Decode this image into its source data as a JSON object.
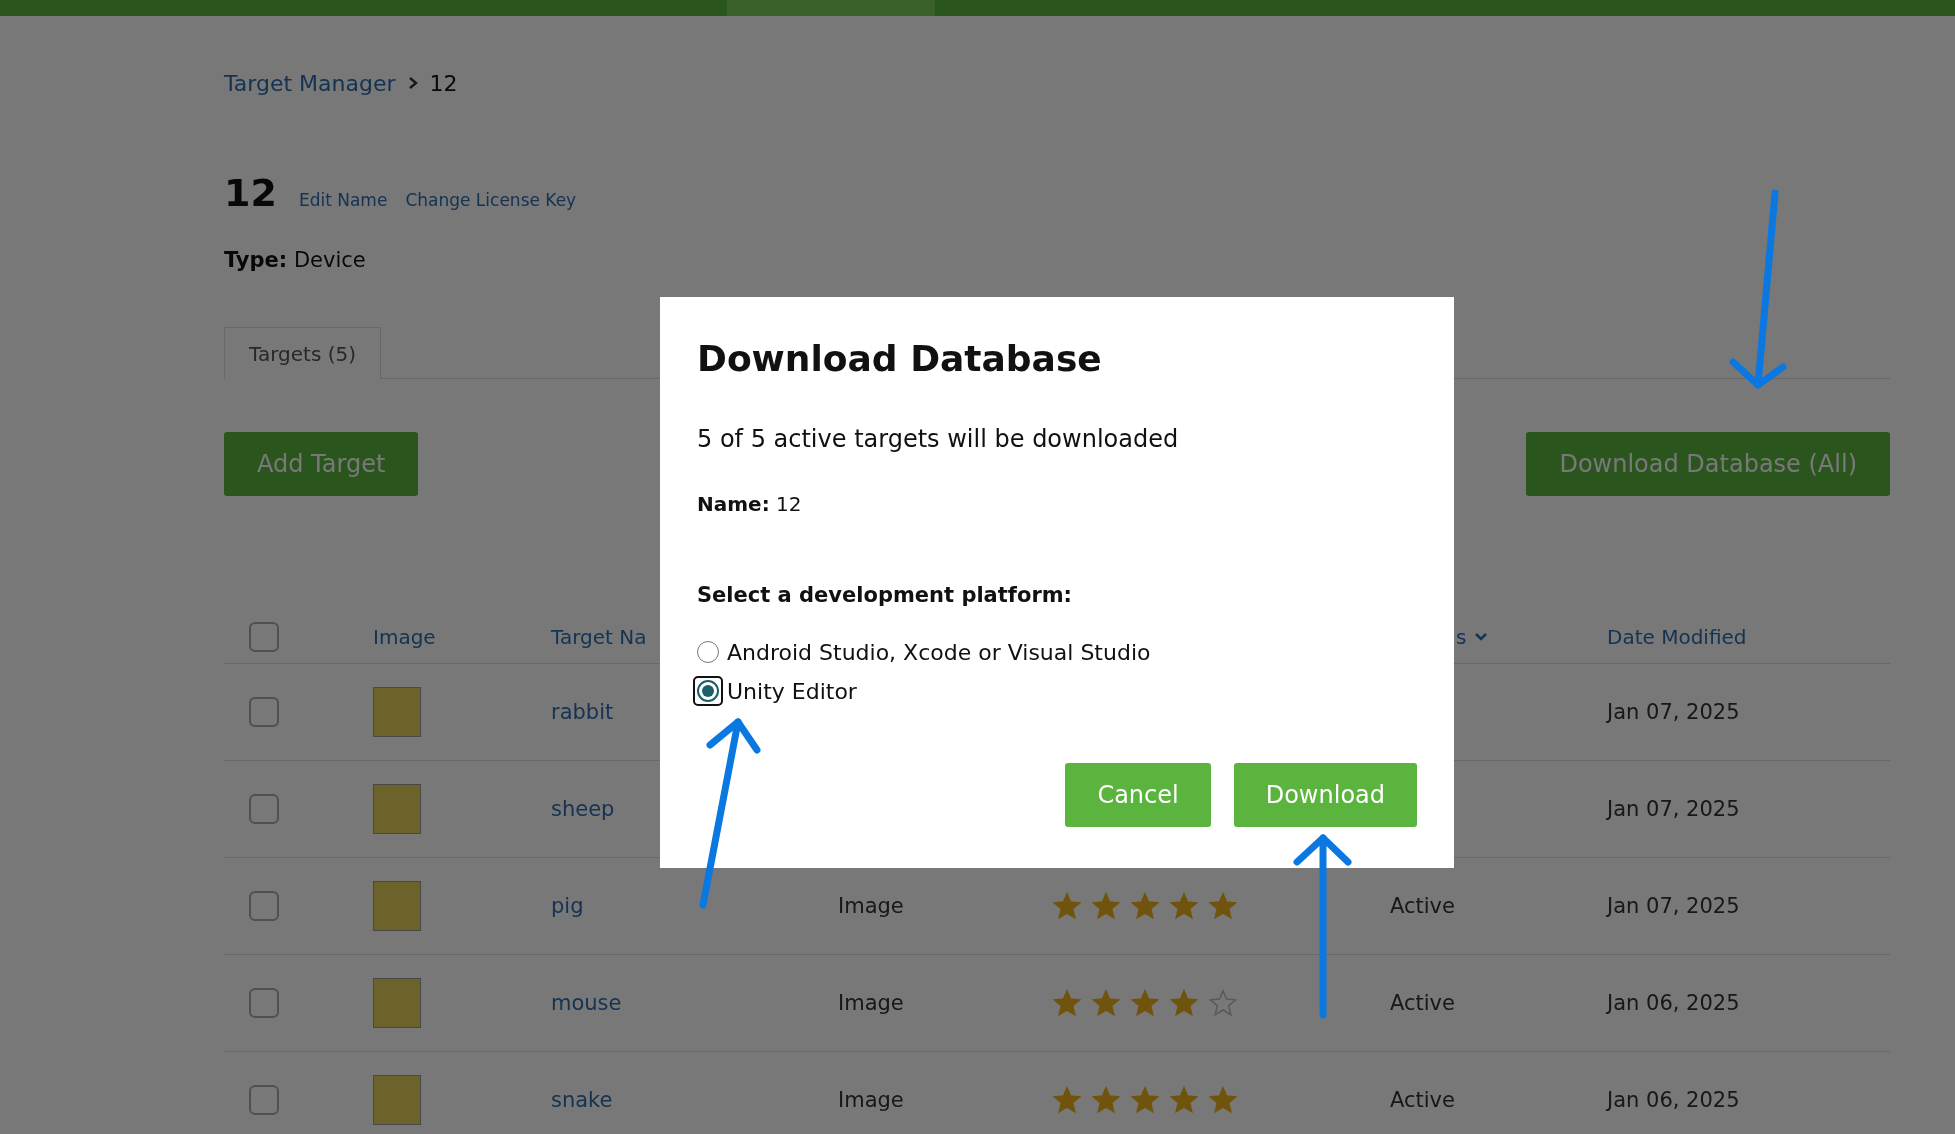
{
  "breadcrumb": [
    {
      "kind": "link",
      "label": "Target Manager"
    },
    {
      "kind": "current",
      "label": "12"
    }
  ],
  "database": {
    "name": "12",
    "actions": [
      "Edit Name",
      "Change License Key"
    ],
    "type_label": "Type:",
    "type_value": "Device"
  },
  "tabs": [
    {
      "label": "Targets (5)",
      "selected": true
    }
  ],
  "actions": {
    "add": "Add Target",
    "download_all": "Download Database (All)"
  },
  "table": {
    "select_all_checked": false,
    "columns": [
      {
        "kind": "image",
        "label": "Image"
      },
      {
        "kind": "name",
        "label": "Target Na"
      },
      {
        "kind": "status",
        "label": "s",
        "sortable": true
      },
      {
        "kind": "date",
        "label": "Date Modified"
      }
    ],
    "rows": [
      {
        "checked": false,
        "name": "rabbit",
        "date": "Jan 07, 2025"
      },
      {
        "checked": false,
        "name": "sheep",
        "date": "Jan 07, 2025"
      },
      {
        "checked": false,
        "name": "pig",
        "type": "Image",
        "stars": 5,
        "status": "Active",
        "date": "Jan 07, 2025"
      },
      {
        "checked": false,
        "name": "mouse",
        "type": "Image",
        "stars": 4,
        "status": "Active",
        "date": "Jan 06, 2025"
      },
      {
        "checked": false,
        "name": "snake",
        "type": "Image",
        "stars": 5,
        "status": "Active",
        "date": "Jan 06, 2025"
      }
    ]
  },
  "dialog": {
    "title": "Download Database",
    "summary": "5 of 5 active targets will be downloaded",
    "name_label": "Name:",
    "name_value": "12",
    "platform_heading": "Select a development platform:",
    "options": [
      {
        "label": "Android Studio, Xcode or Visual Studio",
        "selected": false
      },
      {
        "label": "Unity Editor",
        "selected": true
      }
    ],
    "buttons": [
      "Cancel",
      "Download"
    ]
  }
}
